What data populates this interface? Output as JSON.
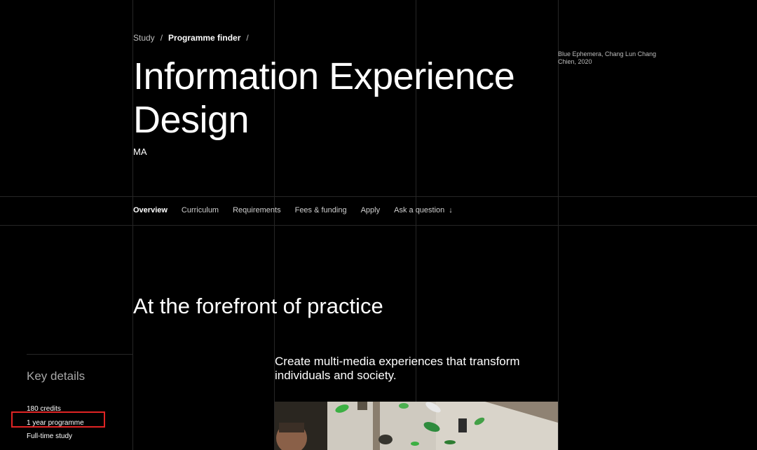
{
  "breadcrumb": {
    "items": [
      "Study",
      "Programme finder"
    ],
    "separator": "/"
  },
  "header": {
    "title": "Information Experience Design",
    "degree": "MA",
    "image_caption": "Blue Ephemera, Chang Lun Chang Chien, 2020"
  },
  "nav": {
    "items": [
      {
        "label": "Overview",
        "active": true
      },
      {
        "label": "Curriculum",
        "active": false
      },
      {
        "label": "Requirements",
        "active": false
      },
      {
        "label": "Fees & funding",
        "active": false
      },
      {
        "label": "Apply",
        "active": false
      },
      {
        "label": "Ask a question",
        "active": false
      }
    ],
    "arrow": "↓"
  },
  "main": {
    "heading": "At the forefront of practice",
    "intro": "Create multi-media experiences that transform individuals and society."
  },
  "key_details": {
    "title": "Key details",
    "items": [
      "180 credits",
      "1 year programme",
      "Full-time study"
    ],
    "highlight_color": "#e02424"
  },
  "colors": {
    "background": "#000000",
    "text": "#ffffff",
    "muted": "#a7a7a7",
    "grid": "#262626"
  }
}
